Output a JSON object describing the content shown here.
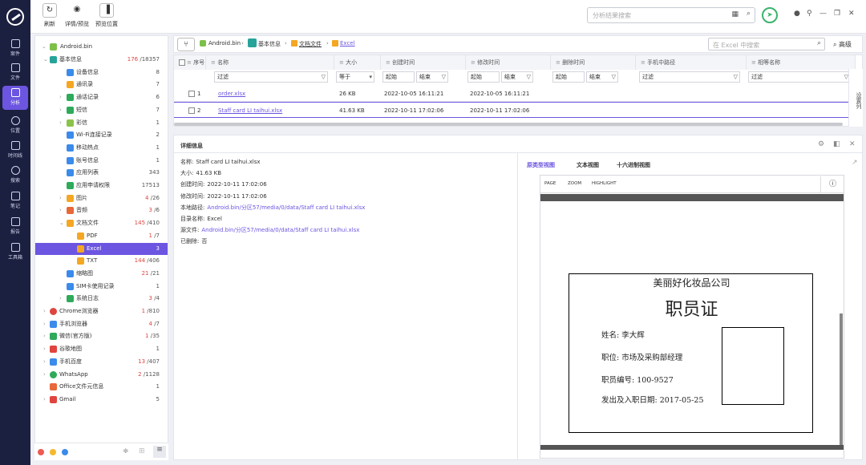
{
  "toolbar": {
    "refresh": "刷新",
    "detail_preview": "详情/预览",
    "preview_pos": "预览位置",
    "search_placeholder": "分析结果搜索"
  },
  "nav": {
    "items": [
      "案件",
      "文件",
      "分析",
      "位置",
      "时间线",
      "搜索",
      "笔记",
      "报告",
      "工具箱"
    ]
  },
  "tree": {
    "root": "Android.bin",
    "items": [
      {
        "label": "基本信息",
        "count_red": "176",
        "count": "/18357"
      },
      {
        "label": "设备信息",
        "count": "8"
      },
      {
        "label": "通讯录",
        "count": "7"
      },
      {
        "label": "通话记录",
        "count": "6"
      },
      {
        "label": "短信",
        "count": "7"
      },
      {
        "label": "彩信",
        "count": "1"
      },
      {
        "label": "Wi-Fi连接记录",
        "count": "2"
      },
      {
        "label": "移动热点",
        "count": "1"
      },
      {
        "label": "账号信息",
        "count": "1"
      },
      {
        "label": "应用列表",
        "count": "343"
      },
      {
        "label": "应用申请权限",
        "count": "17513"
      },
      {
        "label": "图片",
        "count_red": "4",
        "count": "/26"
      },
      {
        "label": "音频",
        "count_red": "3",
        "count": "/6"
      },
      {
        "label": "文档文件",
        "count_red": "145",
        "count": "/410"
      },
      {
        "label": "PDF",
        "count_red": "1",
        "count": "/7"
      },
      {
        "label": "Excel",
        "count": "3"
      },
      {
        "label": "TXT",
        "count_red": "144",
        "count": "/406"
      },
      {
        "label": "缩略图",
        "count_red": "21",
        "count": "/21"
      },
      {
        "label": "SIM卡使用记录",
        "count": "1"
      },
      {
        "label": "系统日志",
        "count_red": "3",
        "count": "/4"
      },
      {
        "label": "Chrome浏览器",
        "count_red": "1",
        "count": "/810"
      },
      {
        "label": "手机浏览器",
        "count_red": "4",
        "count": "/7"
      },
      {
        "label": "微信(官方版)",
        "count_red": "1",
        "count": "/35"
      },
      {
        "label": "谷歌地图",
        "count": "1"
      },
      {
        "label": "手机百度",
        "count_red": "13",
        "count": "/407"
      },
      {
        "label": "WhatsApp",
        "count_red": "2",
        "count": "/1128"
      },
      {
        "label": "Office文件元信息",
        "count": "1"
      },
      {
        "label": "Gmail",
        "count": "5"
      }
    ]
  },
  "breadcrumb": {
    "items": [
      "Android.bin",
      "基本信息",
      "文档文件",
      "Excel"
    ],
    "search_placeholder": "在 Excel 中搜索",
    "advanced": "高级"
  },
  "list": {
    "headers": [
      "序号",
      "名称",
      "大小",
      "创建时间",
      "修改时间",
      "删除时间",
      "手机中路径",
      "相等名称"
    ],
    "filter": "过滤",
    "size_op": "等于",
    "start": "起始",
    "end": "结束",
    "rows": [
      {
        "no": "1",
        "name": "order.xlsx",
        "size": "26 KB",
        "created": "2022-10-05 16:11:21",
        "modified": "2022-10-05 16:11:21"
      },
      {
        "no": "2",
        "name": "Staff card LI taihui.xlsx",
        "size": "41.63 KB",
        "created": "2022-10-11 17:02:06",
        "modified": "2022-10-11 17:02:06"
      }
    ],
    "settings_col": "设置列"
  },
  "detail": {
    "title": "详细信息",
    "fields": [
      {
        "k": "名称:",
        "v": "Staff card LI taihui.xlsx"
      },
      {
        "k": "大小:",
        "v": "41.63 KB"
      },
      {
        "k": "创建时间:",
        "v": "2022-10-11 17:02:06"
      },
      {
        "k": "修改时间:",
        "v": "2022-10-11 17:02:06"
      },
      {
        "k": "本地路径:",
        "v": "Android.bin/分区57/media/0/data/Staff card LI taihui.xlsx",
        "link": true
      },
      {
        "k": "目录名称:",
        "v": "Excel"
      },
      {
        "k": "源文件:",
        "v": "Android.bin/分区57/media/0/data/Staff card LI taihui.xlsx",
        "link": true
      },
      {
        "k": "已删除:",
        "v": "否"
      }
    ],
    "tabs": [
      "原类型视图",
      "文本视图",
      "十六进制视图"
    ],
    "viewer_tools": [
      "PAGE",
      "ZOOM",
      "HIGHLIGHT"
    ]
  },
  "card": {
    "company": "美丽好化妆品公司",
    "title": "职员证",
    "name": "姓名: 李大辉",
    "position": "职位: 市场及采购部经理",
    "number": "职员编号: 100-9527",
    "date": "发出及入职日期: 2017-05-25"
  },
  "colors": {
    "accent": "#6c55e0",
    "nav_bg": "#1c2040",
    "green": "#3bb46e",
    "red": "#e0443e"
  }
}
